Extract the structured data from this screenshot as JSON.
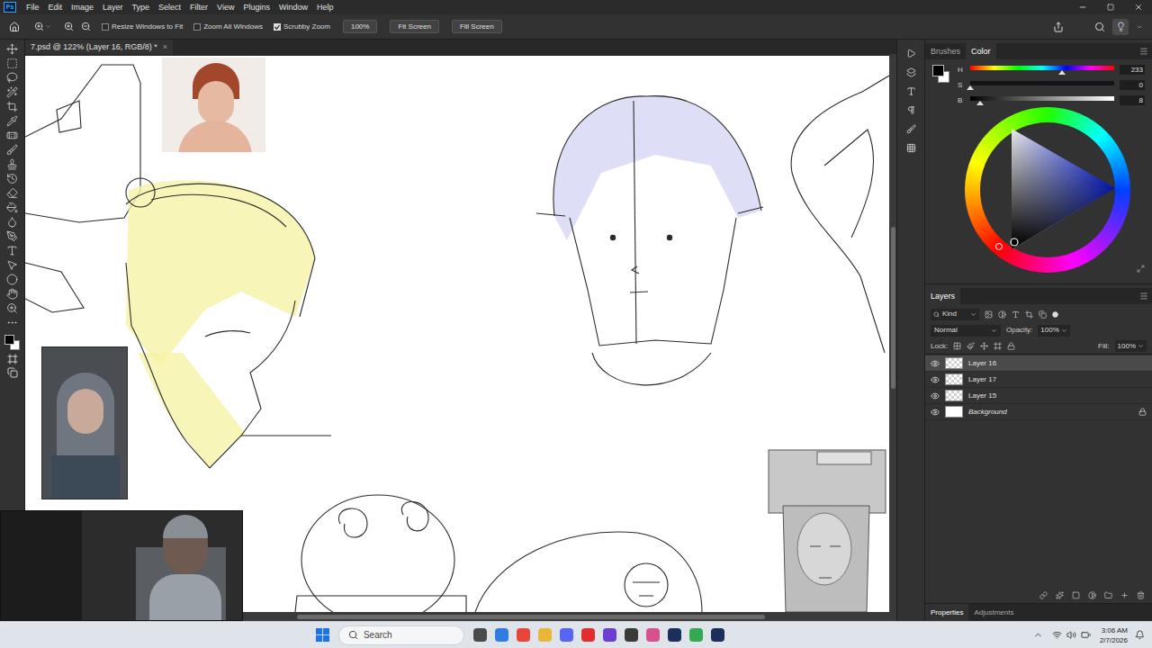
{
  "app": {
    "logo": "Ps"
  },
  "menu": [
    "File",
    "Edit",
    "Image",
    "Layer",
    "Type",
    "Select",
    "Filter",
    "View",
    "Plugins",
    "Window",
    "Help"
  ],
  "options_bar": {
    "checkboxes": [
      {
        "label": "Resize Windows to Fit",
        "checked": false
      },
      {
        "label": "Zoom All Windows",
        "checked": false
      },
      {
        "label": "Scrubby Zoom",
        "checked": true
      }
    ],
    "buttons": [
      "100%",
      "Fit Screen",
      "Fill Screen"
    ]
  },
  "document_tab": {
    "title": "7.psd @ 122% (Layer 16, RGB/8) *",
    "close": "×"
  },
  "color_panel": {
    "tabs": [
      {
        "label": "Brushes",
        "selected": false
      },
      {
        "label": "Color",
        "selected": true
      }
    ],
    "sliders": [
      {
        "name": "H",
        "value": "233",
        "level": 0.64
      },
      {
        "name": "S",
        "value": "0",
        "level": 0
      },
      {
        "name": "B",
        "value": "8",
        "level": 0.07
      }
    ]
  },
  "layers_panel": {
    "tabs": [
      {
        "label": "Layers",
        "selected": true
      }
    ],
    "filter": "Kind",
    "blend_mode": "Normal",
    "opacity_label": "Opacity:",
    "opacity": "100%",
    "lock_label": "Lock:",
    "fill_label": "Fill:",
    "fill": "100%",
    "layers": [
      {
        "name": "Layer 16",
        "selected": true,
        "visible": true,
        "locked": false,
        "kind": "transparent"
      },
      {
        "name": "Layer 17",
        "selected": false,
        "visible": true,
        "locked": false,
        "kind": "transparent"
      },
      {
        "name": "Layer 15",
        "selected": false,
        "visible": true,
        "locked": false,
        "kind": "transparent"
      },
      {
        "name": "Background",
        "selected": false,
        "visible": true,
        "locked": true,
        "kind": "fill"
      }
    ]
  },
  "bottom_tabs": [
    {
      "label": "Properties",
      "selected": true
    },
    {
      "label": "Adjustments",
      "selected": false
    }
  ],
  "taskbar": {
    "search": "Search",
    "time": "3:06 AM",
    "date": "2/7/2026"
  }
}
